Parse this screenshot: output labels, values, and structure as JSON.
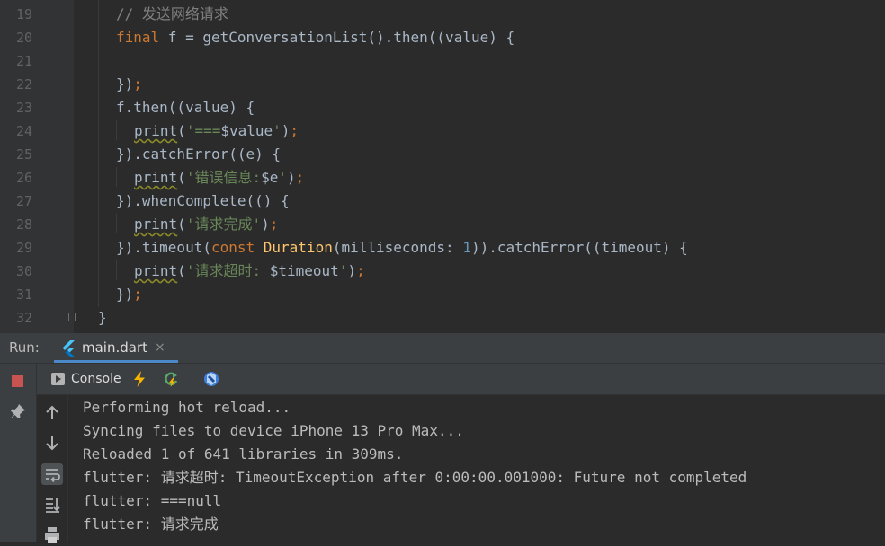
{
  "editor": {
    "line_numbers": [
      "19",
      "20",
      "21",
      "22",
      "23",
      "24",
      "25",
      "26",
      "27",
      "28",
      "29",
      "30",
      "31",
      "32"
    ],
    "lines": [
      [
        {
          "t": "// 发送网络请求",
          "c": "cm"
        }
      ],
      [
        {
          "t": "final",
          "c": "kw"
        },
        {
          "t": " f = getConversationList().then((value) {",
          "c": "punc"
        }
      ],
      [],
      [
        {
          "t": "})",
          "c": "punc"
        },
        {
          "t": ";",
          "c": "semi"
        }
      ],
      [
        {
          "t": "f.then((value) {",
          "c": "punc"
        }
      ],
      [
        {
          "t": "print",
          "c": "fn squig"
        },
        {
          "t": "(",
          "c": "punc"
        },
        {
          "t": "'===",
          "c": "str"
        },
        {
          "t": "$value",
          "c": "punc"
        },
        {
          "t": "'",
          "c": "str"
        },
        {
          "t": ")",
          "c": "punc"
        },
        {
          "t": ";",
          "c": "semi"
        }
      ],
      [
        {
          "t": "}).catchError((e) {",
          "c": "punc"
        }
      ],
      [
        {
          "t": "print",
          "c": "fn squig"
        },
        {
          "t": "(",
          "c": "punc"
        },
        {
          "t": "'错误信息:",
          "c": "str"
        },
        {
          "t": "$e",
          "c": "punc"
        },
        {
          "t": "'",
          "c": "str"
        },
        {
          "t": ")",
          "c": "punc"
        },
        {
          "t": ";",
          "c": "semi"
        }
      ],
      [
        {
          "t": "}).whenComplete(() {",
          "c": "punc"
        }
      ],
      [
        {
          "t": "print",
          "c": "fn squig"
        },
        {
          "t": "(",
          "c": "punc"
        },
        {
          "t": "'请求完成'",
          "c": "str"
        },
        {
          "t": ")",
          "c": "punc"
        },
        {
          "t": ";",
          "c": "semi"
        }
      ],
      [
        {
          "t": "}).timeout(",
          "c": "punc"
        },
        {
          "t": "const ",
          "c": "kw"
        },
        {
          "t": "Duration",
          "c": "cls"
        },
        {
          "t": "(milliseconds: ",
          "c": "punc"
        },
        {
          "t": "1",
          "c": "num"
        },
        {
          "t": ")).catchError((timeout) {",
          "c": "punc"
        }
      ],
      [
        {
          "t": "print",
          "c": "fn squig"
        },
        {
          "t": "(",
          "c": "punc"
        },
        {
          "t": "'请求超时: ",
          "c": "str"
        },
        {
          "t": "$timeout",
          "c": "punc"
        },
        {
          "t": "'",
          "c": "str"
        },
        {
          "t": ")",
          "c": "punc"
        },
        {
          "t": ";",
          "c": "semi"
        }
      ],
      [
        {
          "t": "})",
          "c": "punc"
        },
        {
          "t": ";",
          "c": "semi"
        }
      ],
      [
        {
          "t": "}",
          "c": "punc"
        }
      ]
    ]
  },
  "run": {
    "label": "Run:",
    "tab_label": "main.dart",
    "tab_close": "×"
  },
  "console": {
    "tab_label": "Console",
    "output": [
      "Performing hot reload...",
      "Syncing files to device iPhone 13 Pro Max...",
      "Reloaded 1 of 641 libraries in 309ms.",
      "flutter: 请求超时: TimeoutException after 0:00:00.001000: Future not completed",
      "flutter: ===null",
      "flutter: 请求完成"
    ]
  },
  "colors": {
    "editor_bg": "#2b2b2b",
    "keyword": "#cc7832",
    "string": "#6a8759",
    "comment": "#808080",
    "class": "#ffc66d",
    "number": "#6897bb",
    "stop": "#c75450",
    "tab_accent": "#4a88c7"
  },
  "icons": {
    "stop": "stop-icon",
    "pin": "pin-icon",
    "console": "console-icon",
    "hot_reload": "hot-reload-lightning-icon",
    "hot_restart": "hot-restart-icon",
    "devtools": "dart-devtools-icon",
    "scroll_up": "arrow-up-icon",
    "scroll_down": "arrow-down-icon",
    "soft_wrap": "soft-wrap-icon",
    "scroll_to_end": "scroll-to-end-icon",
    "print": "print-icon"
  }
}
